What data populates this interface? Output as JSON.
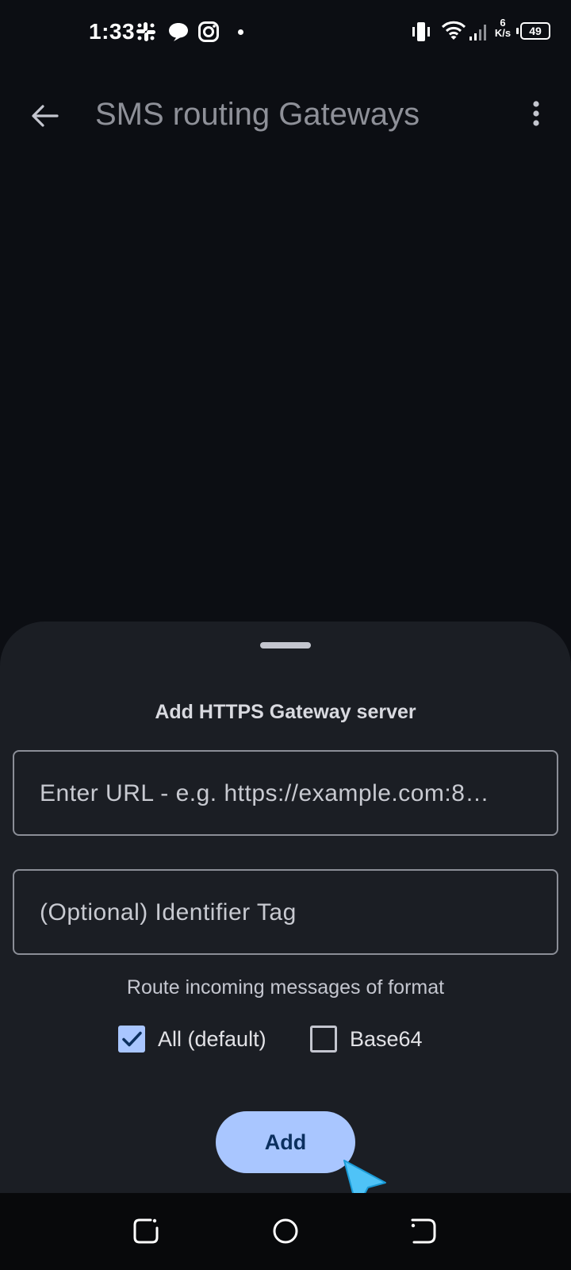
{
  "status_bar": {
    "time": "1:33",
    "net_speed_value": "6",
    "net_speed_unit": "K/s",
    "battery": "49",
    "icons": [
      "slack-icon",
      "chat-bubble-icon",
      "instagram-icon",
      "notification-dot",
      "vibrate-icon",
      "wifi-icon",
      "signal-icon",
      "battery-icon"
    ]
  },
  "app_bar": {
    "title": "SMS routing Gateways",
    "back_icon": "arrow-back-icon",
    "menu_icon": "more-vert-icon"
  },
  "sheet": {
    "title": "Add HTTPS Gateway server",
    "url_input": {
      "placeholder": "Enter URL - e.g. https://example.com:8…",
      "value": ""
    },
    "tag_input": {
      "placeholder": "(Optional) Identifier Tag",
      "value": ""
    },
    "route_label": "Route incoming messages of format",
    "options": [
      {
        "label": "All (default)",
        "checked": true
      },
      {
        "label": "Base64",
        "checked": false
      }
    ],
    "add_button": "Add"
  },
  "nav_bar": {
    "items": [
      "recents-icon",
      "home-icon",
      "back-nav-icon"
    ]
  },
  "colors": {
    "background": "#0c0e13",
    "sheet": "#1b1e24",
    "accent": "#a9c6ff",
    "accent_text": "#0c305f",
    "cursor": "#4fc3f7"
  }
}
